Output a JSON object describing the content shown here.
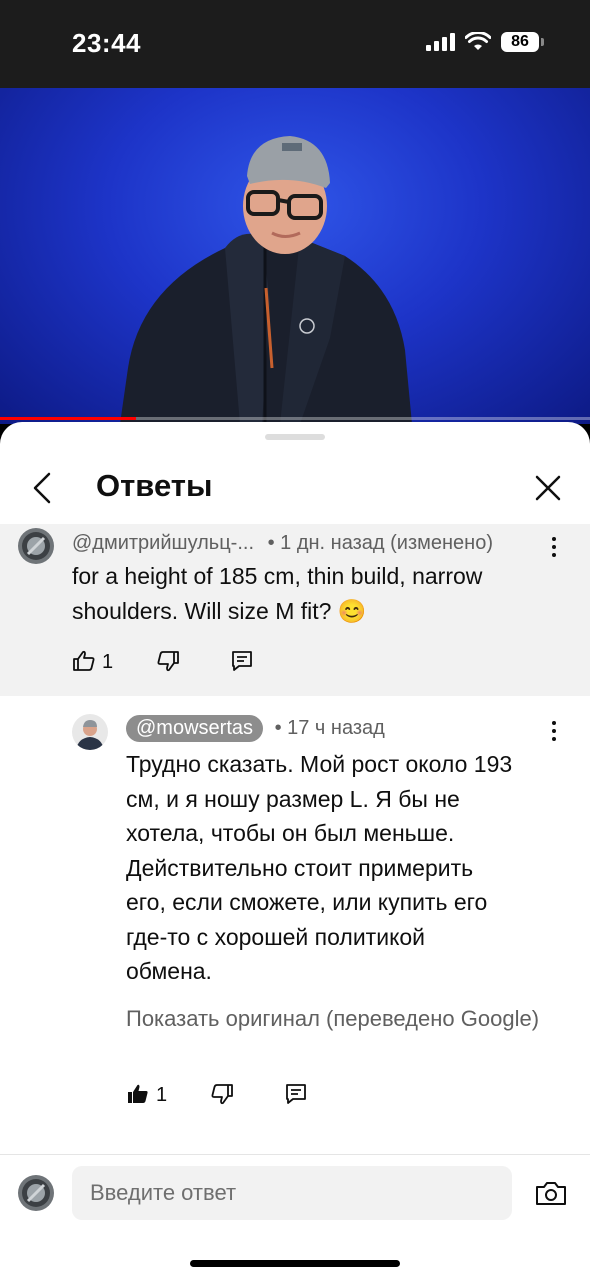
{
  "status_bar": {
    "time": "23:44",
    "battery": "86"
  },
  "video": {
    "progress_percent": 23
  },
  "header": {
    "title": "Ответы"
  },
  "parent_comment": {
    "author": "@дмитрийшульц-...",
    "meta": "• 1 дн. назад (изменено)",
    "text": "for a height of 185 cm, thin build, narrow shoulders. Will size M fit? 😊",
    "like_count": "1"
  },
  "reply": {
    "author": "@mowsertas",
    "meta": "• 17 ч назад",
    "text_lines": [
      "Трудно сказать. Мой рост около 193",
      "см, и я ношу размер L. Я бы не",
      "хотела, чтобы он был меньше.",
      "Действительно стоит примерить",
      "его, если сможете, или купить его",
      "где-то с хорошей политикой",
      "обмена."
    ],
    "show_original": "Показать оригинал (переведено Google)",
    "like_count": "1",
    "liked": true
  },
  "reply_bar": {
    "placeholder": "Введите ответ"
  },
  "icons": {
    "back": "chevron-left-icon",
    "close": "close-icon",
    "like": "thumbs-up-icon",
    "dislike": "thumbs-down-icon",
    "reply": "comment-icon",
    "more": "more-vertical-icon",
    "camera": "camera-icon"
  },
  "colors": {
    "accent": "#ff0000",
    "sheet_bg": "#ffffff",
    "highlight_bg": "#f2f2f2"
  }
}
